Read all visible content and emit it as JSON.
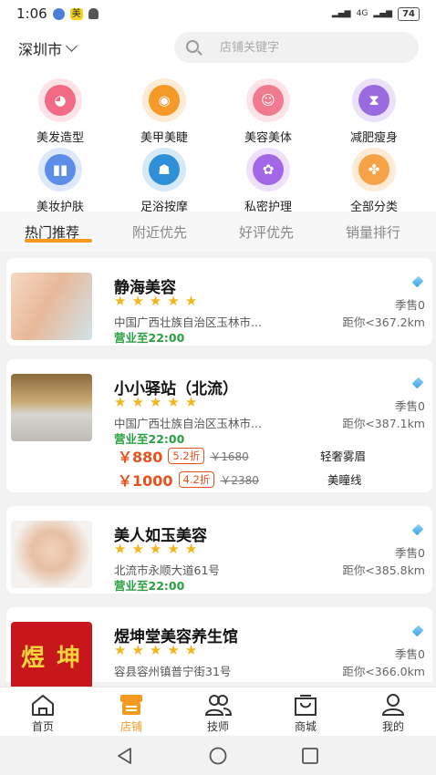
{
  "status_bar": {
    "time": "1:06",
    "mei_badge": "美",
    "signal_text": "4G",
    "battery": "74"
  },
  "header": {
    "city": "深圳市",
    "search_placeholder": "店铺关键字"
  },
  "categories": [
    {
      "label": "美发造型",
      "icon": "hair-icon",
      "color": "#f26b84"
    },
    {
      "label": "美甲美睫",
      "icon": "eye-icon",
      "color": "#f59a28"
    },
    {
      "label": "美容美体",
      "icon": "face-icon",
      "color": "#f27a8e"
    },
    {
      "label": "减肥瘦身",
      "icon": "body-icon",
      "color": "#9a6be0"
    },
    {
      "label": "美妆护肤",
      "icon": "cosmetics-icon",
      "color": "#5c8ee8"
    },
    {
      "label": "足浴按摩",
      "icon": "massage-icon",
      "color": "#2f8fd8"
    },
    {
      "label": "私密护理",
      "icon": "flower-icon",
      "color": "#a267e6"
    },
    {
      "label": "全部分类",
      "icon": "grid-icon",
      "color": "#f6a348"
    }
  ],
  "tabs": [
    {
      "label": "热门推荐",
      "active": true
    },
    {
      "label": "附近优先",
      "active": false
    },
    {
      "label": "好评优先",
      "active": false
    },
    {
      "label": "销量排行",
      "active": false
    }
  ],
  "shops": [
    {
      "name": "静海美容",
      "rating": 5,
      "address": "中国广西壮族自治区玉林市...",
      "hours": "营业至22:00",
      "sales": "季售0",
      "distance": "距你<367.2km",
      "deals": []
    },
    {
      "name": "小小驿站（北流）",
      "rating": 5,
      "address": "中国广西壮族自治区玉林市...",
      "hours": "营业至22:00",
      "sales": "季售0",
      "distance": "距你<387.1km",
      "deals": [
        {
          "price": "￥880",
          "discount": "5.2折",
          "original": "￥1680",
          "name": "轻奢雾眉"
        },
        {
          "price": "￥1000",
          "discount": "4.2折",
          "original": "￥2380",
          "name": "美瞳线"
        }
      ]
    },
    {
      "name": "美人如玉美容",
      "rating": 5,
      "address": "北流市永顺大道61号",
      "hours": "营业至22:00",
      "sales": "季售0",
      "distance": "距你<385.8km",
      "deals": []
    },
    {
      "name": "煜坤堂美容养生馆",
      "rating": 5,
      "address": "容县容州镇普宁街31号",
      "hours": "",
      "sales": "季售0",
      "distance": "距你<366.0km",
      "thumb_text": "煜 坤",
      "deals": []
    }
  ],
  "bottom_nav": [
    {
      "label": "首页",
      "icon": "home-icon",
      "active": false
    },
    {
      "label": "店铺",
      "icon": "store-icon",
      "active": true
    },
    {
      "label": "技师",
      "icon": "technician-icon",
      "active": false
    },
    {
      "label": "商城",
      "icon": "mall-icon",
      "active": false
    },
    {
      "label": "我的",
      "icon": "profile-icon",
      "active": false
    }
  ],
  "colors": {
    "accent": "#f39a1f",
    "price": "#e8501d",
    "open": "#2aa041",
    "star": "#f2b51c"
  }
}
